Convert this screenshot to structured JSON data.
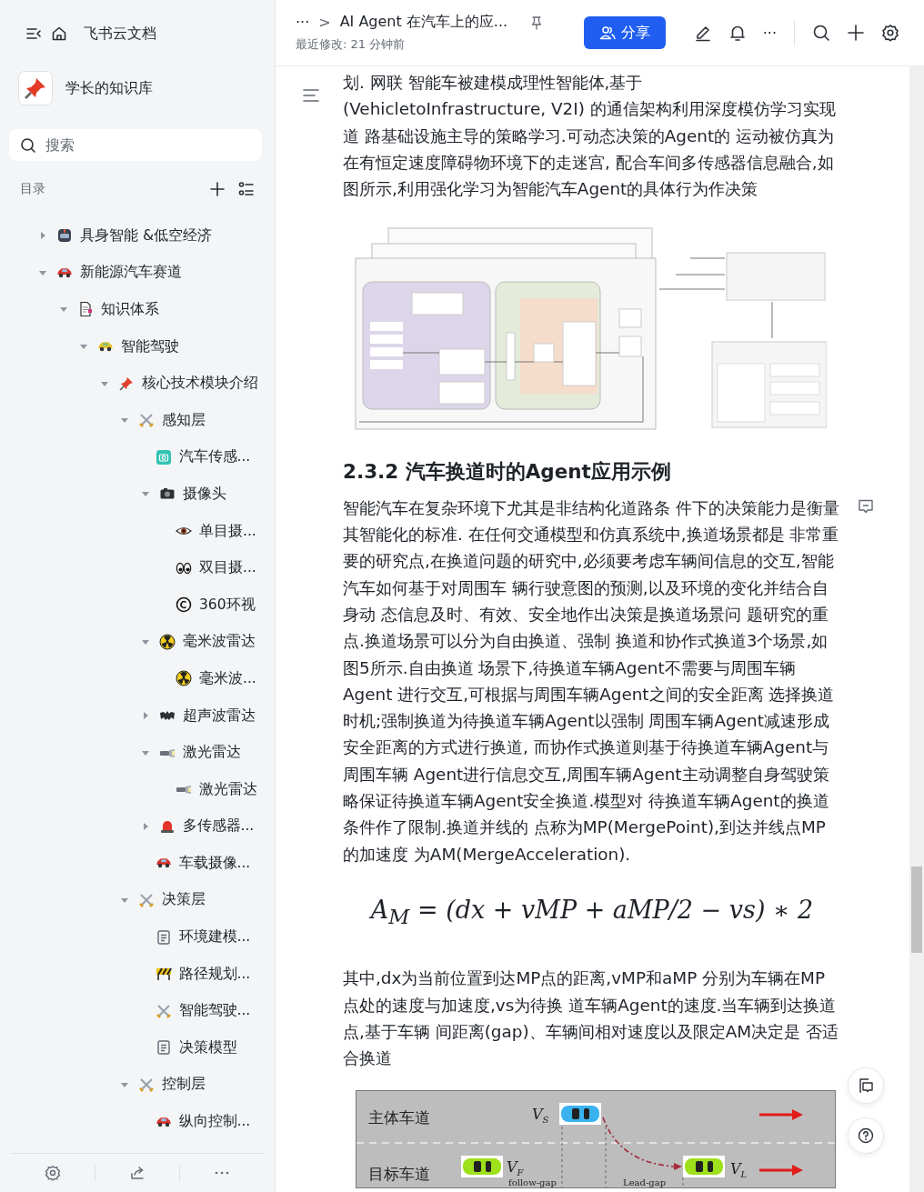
{
  "sidebar": {
    "app_name": "飞书云文档",
    "space_name": "学长的知识库",
    "search": {
      "placeholder": "搜索"
    },
    "toc_label": "目录",
    "tree": [
      {
        "label": "具身智能 &低空经济",
        "kind": "robot",
        "expanded": false
      },
      {
        "label": "新能源汽车赛道",
        "kind": "car",
        "expanded": true,
        "children": [
          {
            "label": "知识体系",
            "kind": "doc",
            "expanded": true,
            "children": [
              {
                "label": "智能驾驶",
                "kind": "taxi",
                "expanded": true,
                "children": [
                  {
                    "label": "核心技术模块介绍",
                    "kind": "pin",
                    "expanded": true,
                    "children": [
                      {
                        "label": "感知层",
                        "kind": "swords",
                        "expanded": true,
                        "children": [
                          {
                            "label": "汽车传感...",
                            "kind": "camera-app"
                          },
                          {
                            "label": "摄像头",
                            "kind": "camera",
                            "expanded": true,
                            "children": [
                              {
                                "label": "单目摄...",
                                "kind": "eye"
                              },
                              {
                                "label": "双目摄...",
                                "kind": "eyes"
                              },
                              {
                                "label": "360环视",
                                "kind": "copyright"
                              }
                            ]
                          },
                          {
                            "label": "毫米波雷达",
                            "kind": "radiation",
                            "expanded": true,
                            "children": [
                              {
                                "label": "毫米波...",
                                "kind": "radiation"
                              }
                            ]
                          },
                          {
                            "label": "超声波雷达",
                            "kind": "bat",
                            "expanded": false
                          },
                          {
                            "label": "激光雷达",
                            "kind": "flashlight",
                            "expanded": true,
                            "children": [
                              {
                                "label": "激光雷达",
                                "kind": "flashlight"
                              }
                            ]
                          },
                          {
                            "label": "多传感器...",
                            "kind": "siren",
                            "expanded": false
                          },
                          {
                            "label": "车载摄像...",
                            "kind": "car"
                          }
                        ]
                      },
                      {
                        "label": "决策层",
                        "kind": "swords",
                        "expanded": true,
                        "children": [
                          {
                            "label": "环境建模...",
                            "kind": "note"
                          },
                          {
                            "label": "路径规划...",
                            "kind": "barrier"
                          },
                          {
                            "label": "智能驾驶...",
                            "kind": "swords"
                          },
                          {
                            "label": "决策模型",
                            "kind": "note"
                          }
                        ]
                      },
                      {
                        "label": "控制层",
                        "kind": "swords",
                        "expanded": true,
                        "children": [
                          {
                            "label": "纵向控制...",
                            "kind": "car"
                          }
                        ]
                      }
                    ]
                  }
                ]
              }
            ]
          }
        ]
      }
    ]
  },
  "header": {
    "breadcrumb_more": "···",
    "breadcrumb_separator": ">",
    "title": "AI Agent 在汽车上的应...",
    "last_modified": "最近修改: 21 分钟前",
    "share_button": "分享",
    "more": "···"
  },
  "document": {
    "blocks": [
      {
        "kind": "paragraph",
        "text": "划. 网联 智能车被建模成理性智能体,基于(VehicletoInfrastructure, V2I) 的通信架构利用深度模仿学习实现道 路基础设施主导的策略学习.可动态决策的Agent的 运动被仿真为在有恒定速度障碍物环境下的走迷宫, 配合车间多传感器信息融合,如图所示,利用强化学习为智能汽车Agent的具体行为作决策"
      },
      {
        "kind": "architecture-figure"
      },
      {
        "kind": "heading",
        "text": "2.3.2 汽车换道时的Agent应用示例"
      },
      {
        "kind": "paragraph",
        "comment": true,
        "text": "智能汽车在复杂环境下尤其是非结构化道路条 件下的决策能力是衡量其智能化的标准. 在任何交通模型和仿真系统中,换道场景都是 非常重要的研究点,在换道问题的研究中,必须要考虑车辆间信息的交互,智能汽车如何基于对周围车 辆行驶意图的预测,以及环境的变化并结合自身动 态信息及时、有效、安全地作出决策是换道场景问 题研究的重点.换道场景可以分为自由换道、强制 换道和协作式换道3个场景,如图5所示.自由换道 场景下,待换道车辆Agent不需要与周围车辆Agent 进行交互,可根据与周围车辆Agent之间的安全距离 选择换道时机;强制换道为待换道车辆Agent以强制 周围车辆Agent减速形成安全距离的方式进行换道, 而协作式换道则基于待换道车辆Agent与周围车辆 Agent进行信息交互,周围车辆Agent主动调整自身驾驶策略保证待换道车辆Agent安全换道.模型对 待换道车辆Agent的换道条件作了限制.换道并线的 点称为MP(MergePoint),到达并线点MP的加速度 为AM(MergeAcceleration)."
      },
      {
        "kind": "formula",
        "text": "A$_{M}$ = (dx + vMP + aMP/2 − vs) ∗ 2"
      },
      {
        "kind": "paragraph",
        "text": "其中,dx为当前位置到达MP点的距离,vMP和aMP 分别为车辆在MP点处的速度与加速度,vs为待换 道车辆Agent的速度.当车辆到达换道点,基于车辆 间距离(gap)、车辆间相对速度以及限定AM决定是 否适合换道"
      },
      {
        "kind": "lane-figure",
        "lanes": [
          "主体车道",
          "目标车道"
        ],
        "labels": {
          "subject_speed": "V$_{S}$",
          "follower_speed": "V$_{F}$",
          "leader_speed": "V$_{L}$",
          "follow_gap": "follow-gap",
          "lead_gap": "Lead-gap"
        }
      }
    ]
  }
}
